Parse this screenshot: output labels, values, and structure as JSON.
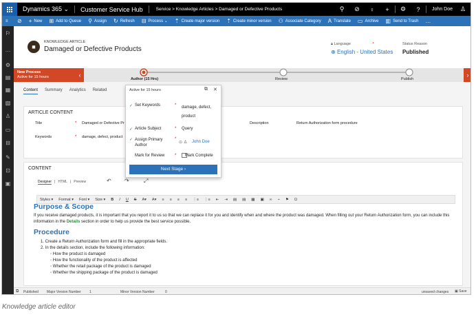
{
  "top_nav": {
    "app_name": "Dynamics 365",
    "chevron": "⌄",
    "area": "Customer Service Hub",
    "breadcrumb": [
      "Service",
      "Knowledge Articles",
      "Damaged or Defective Products"
    ],
    "breadcrumb_sep": ">",
    "user": "John Doe"
  },
  "commands": [
    {
      "icon": "save-icon",
      "glyph": "⊘",
      "label": ""
    },
    {
      "icon": "plus-icon",
      "glyph": "+",
      "label": "New"
    },
    {
      "icon": "queue-icon",
      "glyph": "⊞",
      "label": "Add to Queue"
    },
    {
      "icon": "assign-icon",
      "glyph": "⚲",
      "label": "Assign"
    },
    {
      "icon": "refresh-icon",
      "glyph": "↻",
      "label": "Refresh"
    },
    {
      "icon": "process-icon",
      "glyph": "⊟",
      "label": "Process ⌄"
    },
    {
      "icon": "major-version-icon",
      "glyph": "⇡",
      "label": "Create major version"
    },
    {
      "icon": "minor-version-icon",
      "glyph": "⇡",
      "label": "Create minor version"
    },
    {
      "icon": "category-icon",
      "glyph": "⚇",
      "label": "Associate Category"
    },
    {
      "icon": "translate-icon",
      "glyph": "A",
      "label": "Translate"
    },
    {
      "icon": "archive-icon",
      "glyph": "▭",
      "label": "Archive"
    },
    {
      "icon": "trash-icon",
      "glyph": "▥",
      "label": "Send to Trash"
    },
    {
      "icon": "more-icon",
      "glyph": "…",
      "label": ""
    }
  ],
  "record": {
    "entity": "KNOWLEDGE ARTICLE",
    "title": "Damaged or Defective Products",
    "language_label": "Language",
    "language_value": "English - United States",
    "status_label": "Status Reason",
    "status_value": "Published"
  },
  "bpf": {
    "process_name": "New Process",
    "process_active": "Active for 15 hours",
    "stages": [
      "Author (15 Hrs)",
      "Review",
      "Publish"
    ]
  },
  "tabs": [
    "Content",
    "Summary",
    "Analytics",
    "Related"
  ],
  "flyout": {
    "title": "Active for 15 hours",
    "fields": [
      {
        "label": "Set Keywords",
        "value": "damage, defect, product"
      },
      {
        "label": "Article Subject",
        "value": "Query"
      },
      {
        "label": "Assign Primary Author",
        "value": "John Doe"
      },
      {
        "label": "Mark for Review",
        "value": "Mark Complete"
      }
    ],
    "next_label": "Next Stage"
  },
  "article_content": {
    "heading": "ARTICLE CONTENT",
    "title_label": "Title",
    "title_value": "Damaged or Defective Products",
    "keywords_label": "Keywords",
    "keywords_value": "damage, defect, product",
    "description_label": "Description",
    "description_value": "Return Authorization form procedure"
  },
  "content": {
    "heading": "CONTENT",
    "editor_tabs": [
      "Designer",
      "HTML",
      "Preview"
    ],
    "toolbar": [
      "Styles ▾",
      "Format ▾",
      "Font ▾",
      "Size ▾",
      "B",
      "I",
      "U",
      "S",
      "A▾",
      "A▾",
      "≡",
      "≡",
      "≡",
      "≡",
      "⋮≡",
      "⋮≡",
      "⇤",
      "⇥",
      "▤",
      "▤",
      "▦",
      "▣",
      "∞",
      "⌁",
      "⚑",
      "Ω"
    ],
    "h1": "Purpose & Scope",
    "para_before": "If you receive damaged products, it is important that you report it to us so that we can replace it for you and identify when and where the product was damaged. When filling out your Return Authorization form, you can include this information in the ",
    "para_link": "Details",
    "para_after": " section in order to help us provide the best service possible.",
    "h2": "Procedure",
    "step1": "1. Create a Return Authorization form and fill in the appropriate fields.",
    "step2": "2. In the details section, include the following information:",
    "bullets": [
      "How the product is damaged",
      "How the functionality of the product is affected",
      "Whether the retail package of the product is damaged",
      "Whether the shipping package of the product is damaged"
    ]
  },
  "status_bar": {
    "state": "Published",
    "major_label": "Major Version Number",
    "major_value": "1",
    "minor_label": "Minor Version Number",
    "minor_value": "0",
    "unsaved": "unsaved changes",
    "save": "Save"
  },
  "caption": "Knowledge article editor",
  "colors": {
    "accent": "#2b72b9",
    "process": "#d24726",
    "heading": "#2b72b9"
  }
}
